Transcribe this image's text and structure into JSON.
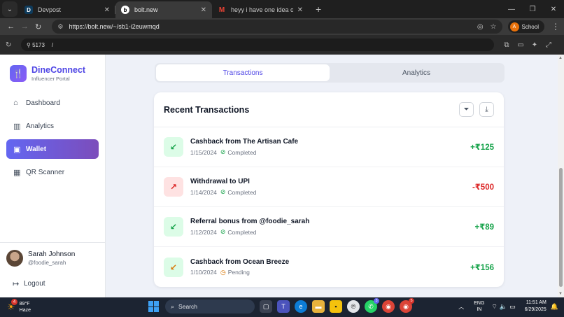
{
  "browser": {
    "tabs": [
      {
        "label": "Devpost",
        "favicon": "D",
        "active": false
      },
      {
        "label": "bolt.new",
        "favicon": "b",
        "active": true
      },
      {
        "label": "heyy i have one idea of a startu",
        "favicon": "M",
        "active": false
      }
    ],
    "url": "https://bolt.new/~/sb1-i2euwmqd",
    "profile_initial": "A",
    "profile_label": "School",
    "dev_port": "5173",
    "dev_path": "/"
  },
  "sidebar": {
    "brand_name": "DineConnect",
    "brand_sub": "Influencer Portal",
    "items": [
      {
        "label": "Dashboard",
        "icon": "home-icon",
        "active": false
      },
      {
        "label": "Analytics",
        "icon": "bar-chart-icon",
        "active": false
      },
      {
        "label": "Wallet",
        "icon": "wallet-icon",
        "active": true
      },
      {
        "label": "QR Scanner",
        "icon": "qr-icon",
        "active": false
      }
    ],
    "user": {
      "name": "Sarah Johnson",
      "handle": "@foodie_sarah"
    },
    "logout_label": "Logout"
  },
  "main": {
    "tabs": [
      {
        "label": "Transactions",
        "active": true
      },
      {
        "label": "Analytics",
        "active": false
      }
    ],
    "card_title": "Recent Transactions",
    "transactions": [
      {
        "title": "Cashback from The Artisan Cafe",
        "date": "1/15/2024",
        "status": "Completed",
        "amount": "+₹125",
        "kind": "credit"
      },
      {
        "title": "Withdrawal to UPI",
        "date": "1/14/2024",
        "status": "Completed",
        "amount": "-₹500",
        "kind": "debit"
      },
      {
        "title": "Referral bonus from @foodie_sarah",
        "date": "1/12/2024",
        "status": "Completed",
        "amount": "+₹89",
        "kind": "credit"
      },
      {
        "title": "Cashback from Ocean Breeze",
        "date": "1/10/2024",
        "status": "Pending",
        "amount": "+₹156",
        "kind": "pending"
      }
    ]
  },
  "taskbar": {
    "weather_temp": "89°F",
    "weather_desc": "Haze",
    "weather_badge": "4",
    "search_label": "Search",
    "whatsapp_badge": "3",
    "chrome_badge": "5",
    "lang_line1": "ENG",
    "lang_line2": "IN",
    "time": "11:51 AM",
    "date": "6/29/2025"
  },
  "colors": {
    "accent": "#4f46e5",
    "active_nav_start": "#6366f1",
    "active_nav_end": "#7c4dbb",
    "credit": "#16a34a",
    "debit": "#dc2626",
    "pending": "#d97706"
  }
}
